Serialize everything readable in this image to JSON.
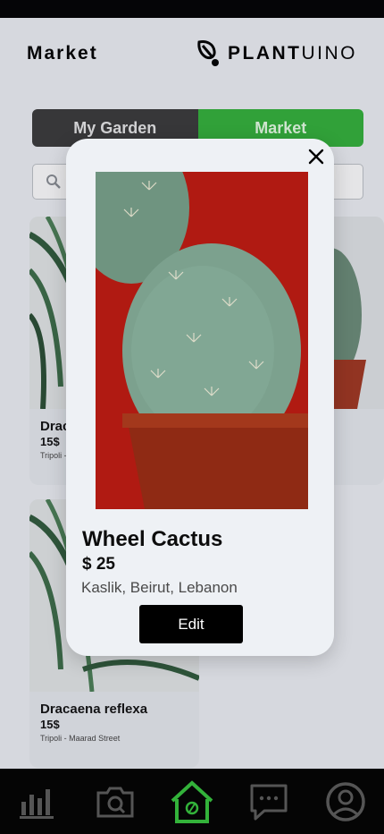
{
  "header": {
    "title": "Market",
    "brand_bold": "PLANT",
    "brand_light": "UINO"
  },
  "toggle": {
    "left_label": "My Garden",
    "right_label": "Market"
  },
  "search": {
    "placeholder": ""
  },
  "cards": [
    {
      "name": "Dracaena reflexa",
      "price": "15$",
      "location": "Tripoli - Maarad Street"
    },
    {
      "name": "Dracaena reflexa",
      "price": "15$",
      "location": "Tripoli - Maarad Street"
    }
  ],
  "modal": {
    "name": "Wheel Cactus",
    "price": "$ 25",
    "location": "Kaslik, Beirut, Lebanon",
    "edit_label": "Edit"
  },
  "nav": {
    "items": [
      "stats-icon",
      "camera-icon",
      "home-icon",
      "chat-icon",
      "profile-icon"
    ],
    "active": "home-icon"
  },
  "colors": {
    "accent": "#33b23a",
    "dark": "#3a3a3a",
    "nav_bg": "#050505",
    "modal_photo_bg": "#b01a12"
  }
}
